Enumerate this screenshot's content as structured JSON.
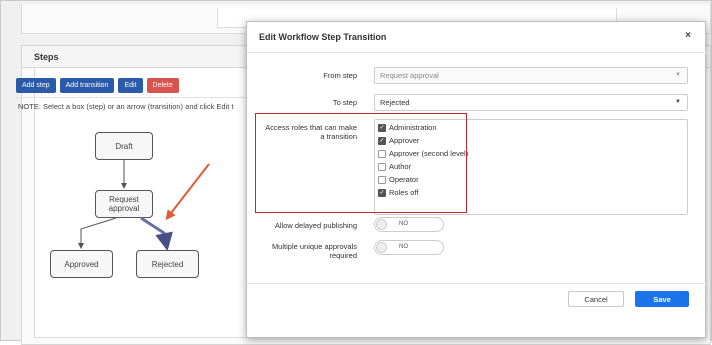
{
  "steps_panel": {
    "title": "Steps",
    "buttons": {
      "add_step": "Add step",
      "add_transition": "Add transition",
      "edit": "Edit",
      "delete": "Delete"
    },
    "note": "NOTE: Select a box (step) or an arrow (transition) and click Edit t",
    "diagram": {
      "nodes": {
        "draft": "Draft",
        "request_approval_line1": "Request",
        "request_approval_line2": "approval",
        "approved": "Approved",
        "rejected": "Rejected"
      }
    }
  },
  "modal": {
    "title": "Edit Workflow Step Transition",
    "close_glyph": "×",
    "from_step": {
      "label": "From step",
      "value": "Request approval"
    },
    "to_step": {
      "label": "To step",
      "value": "Rejected"
    },
    "access_roles": {
      "label_line1": "Access roles that can make",
      "label_line2": "a transition",
      "roles": [
        {
          "name": "Administration",
          "checked": true
        },
        {
          "name": "Approver",
          "checked": true
        },
        {
          "name": "Approver (second level)",
          "checked": false
        },
        {
          "name": "Author",
          "checked": false
        },
        {
          "name": "Operator",
          "checked": false
        },
        {
          "name": "Roles off",
          "checked": true
        }
      ]
    },
    "delayed_publishing": {
      "label": "Allow delayed publishing",
      "state": "NO"
    },
    "multiple_approvals": {
      "label_line1": "Multiple unique approvals",
      "label_line2": "required",
      "state": "NO"
    },
    "cancel_label": "Cancel",
    "save_label": "Save"
  },
  "colors": {
    "highlight_box": "#c0282f",
    "annotation_arrow": "#e0593a",
    "selected_edge": "#6a6fa3",
    "save_button": "#1a73e8",
    "step_button": "#2a5aa8",
    "delete_button": "#d9534f"
  },
  "icons": {
    "close": "close-icon",
    "dropdown": "chevron-down-icon",
    "checkbox_checked": "check-icon"
  }
}
